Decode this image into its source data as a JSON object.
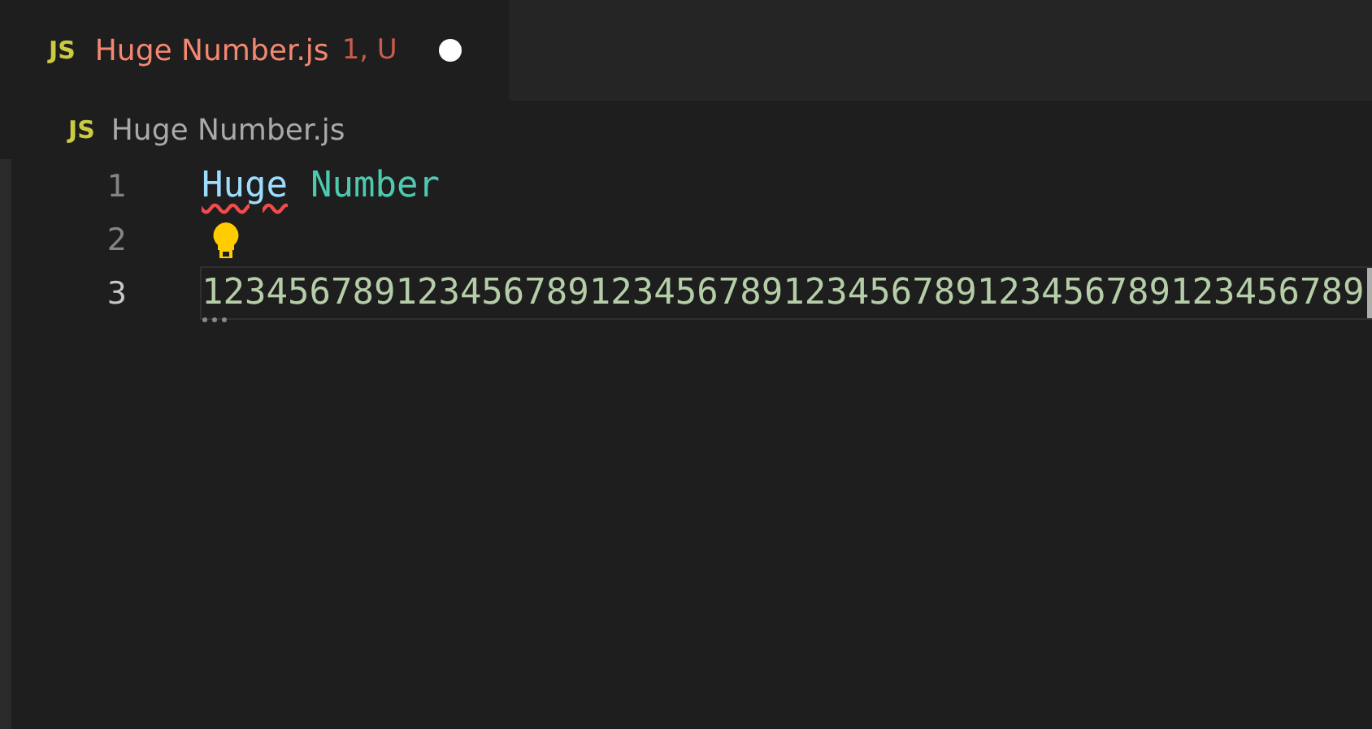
{
  "tabs": [
    {
      "icon_label": "JS",
      "title": "Huge Number.js",
      "badge": "1, U",
      "selected": true,
      "modified": true
    }
  ],
  "breadcrumb": {
    "icon_label": "JS",
    "title": "Huge Number.js"
  },
  "lines": [
    {
      "number": "1",
      "active": false,
      "tokens": [
        {
          "kind": "variable",
          "text": "Huge",
          "error": true
        },
        {
          "kind": "identifier",
          "text": "Number",
          "error": false
        }
      ]
    },
    {
      "number": "2",
      "active": false,
      "lightbulb": true
    },
    {
      "number": "3",
      "active": true,
      "tokens": [
        {
          "kind": "number",
          "text": "123456789123456789123456789123456789123456789123456789",
          "error": false
        }
      ],
      "hint": true
    }
  ]
}
